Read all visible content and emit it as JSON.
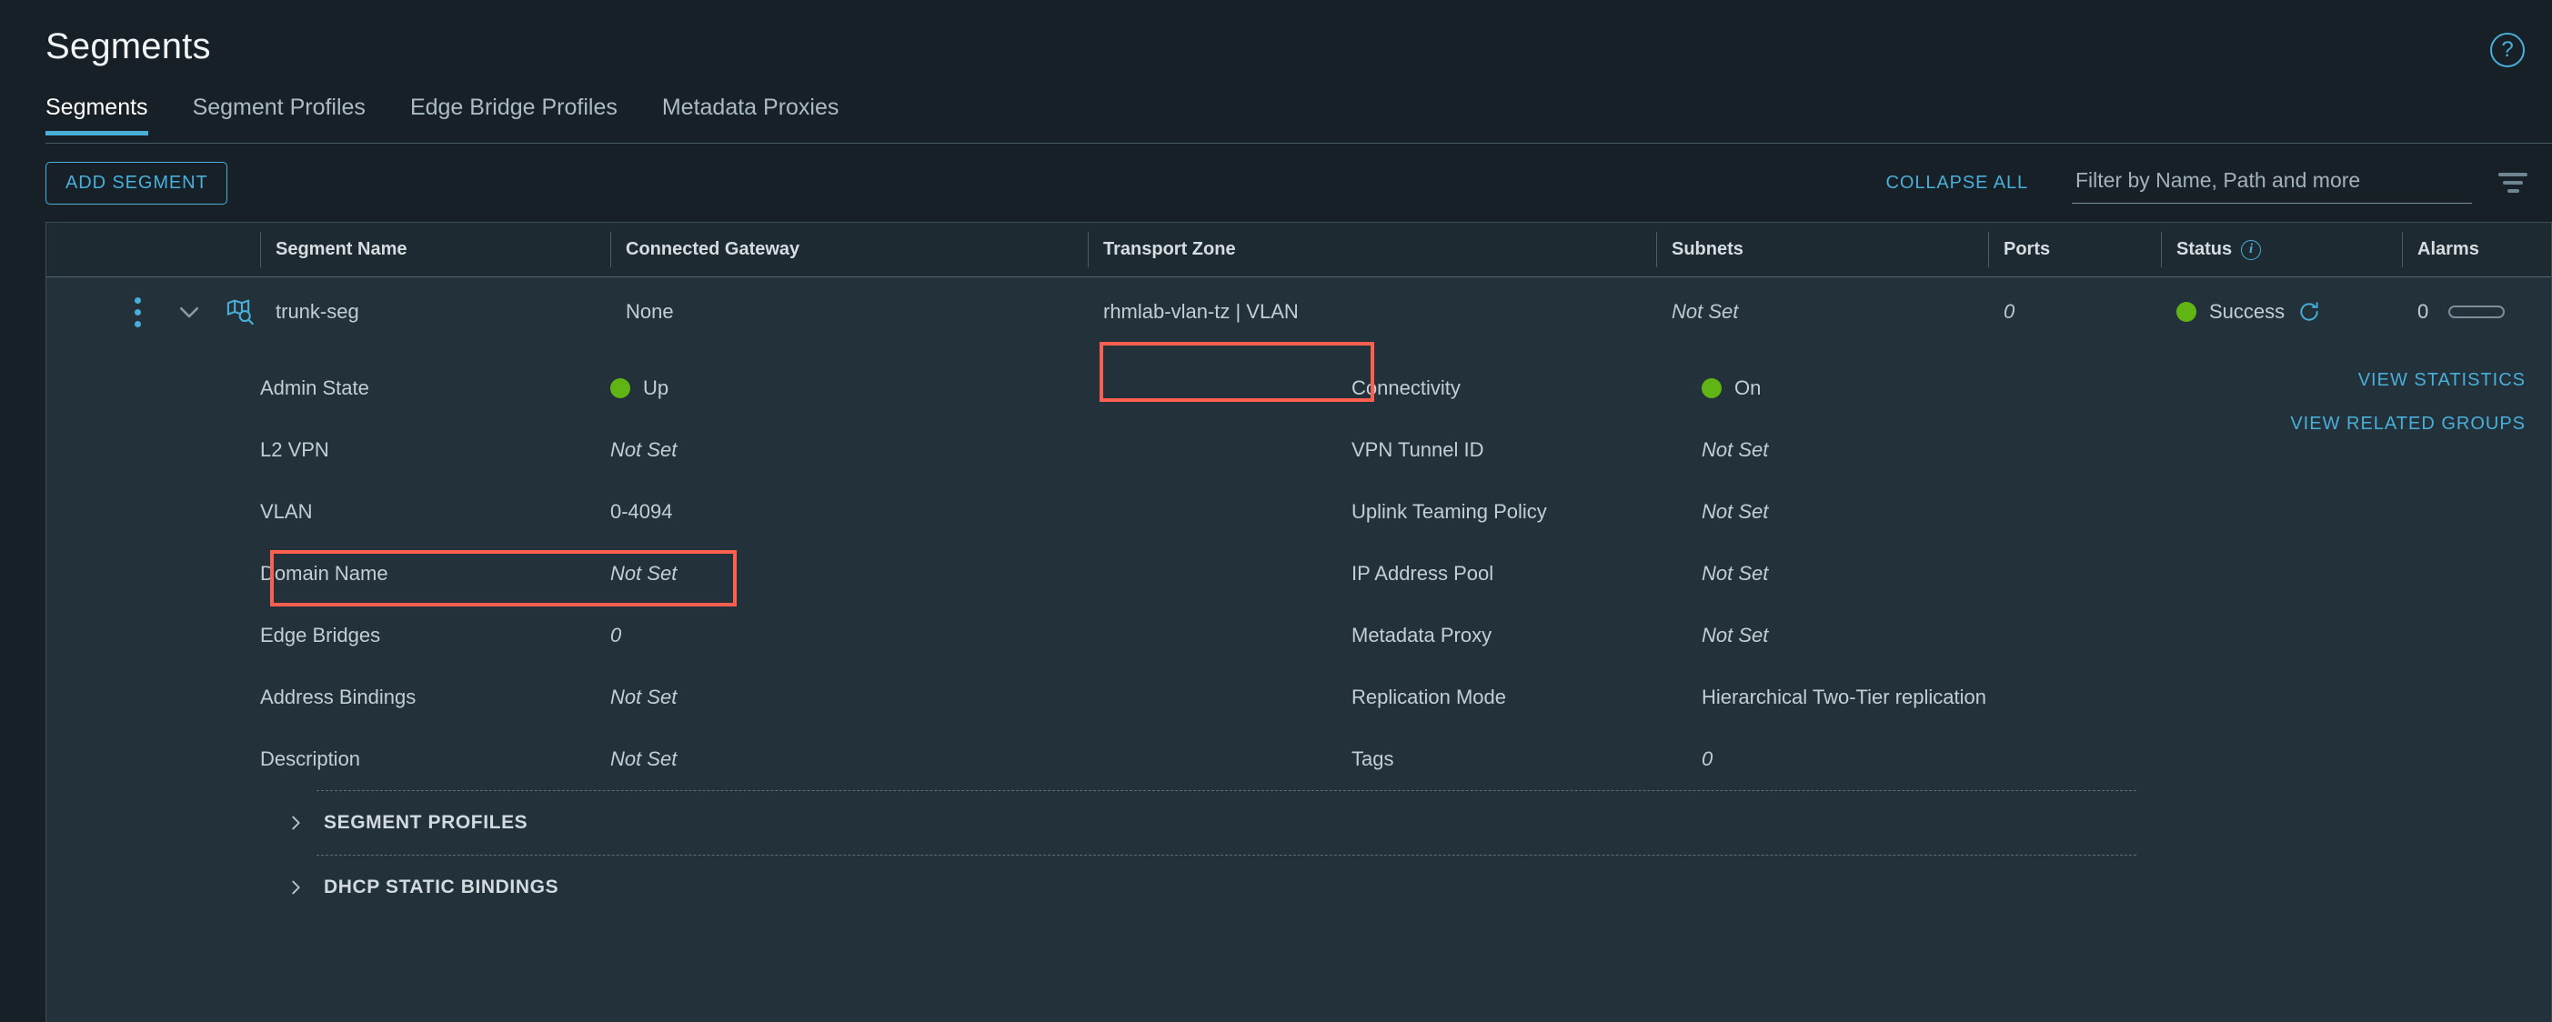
{
  "page": {
    "title": "Segments",
    "help_icon": "help-circle-icon",
    "help_glyph": "?"
  },
  "tabs": [
    {
      "label": "Segments",
      "active": true
    },
    {
      "label": "Segment Profiles",
      "active": false
    },
    {
      "label": "Edge Bridge Profiles",
      "active": false
    },
    {
      "label": "Metadata Proxies",
      "active": false
    }
  ],
  "toolbar": {
    "add_segment_label": "ADD SEGMENT",
    "collapse_all_label": "COLLAPSE ALL",
    "filter_placeholder": "Filter by Name, Path and more",
    "filter_value": "",
    "filter_icon": "filter-icon"
  },
  "table": {
    "columns": [
      {
        "key": "controls",
        "label": ""
      },
      {
        "key": "name",
        "label": "Segment Name"
      },
      {
        "key": "gateway",
        "label": "Connected Gateway"
      },
      {
        "key": "tz",
        "label": "Transport Zone"
      },
      {
        "key": "subnets",
        "label": "Subnets"
      },
      {
        "key": "ports",
        "label": "Ports"
      },
      {
        "key": "status",
        "label": "Status"
      },
      {
        "key": "alarms",
        "label": "Alarms"
      }
    ],
    "status_info_tooltip": "i",
    "row": {
      "segment_name": "trunk-seg",
      "connected_gateway": "None",
      "transport_zone": "rhmlab-vlan-tz | VLAN",
      "subnets": "Not Set",
      "ports": "0",
      "status_text": "Success",
      "status_color": "#60b515",
      "alarms": "0"
    }
  },
  "detail": {
    "left": [
      {
        "label": "Admin State",
        "value": "Up",
        "dot": true,
        "italic": false
      },
      {
        "label": "L2 VPN",
        "value": "Not Set",
        "dot": false,
        "italic": true
      },
      {
        "label": "VLAN",
        "value": "0-4094",
        "dot": false,
        "italic": false
      },
      {
        "label": "Domain Name",
        "value": "Not Set",
        "dot": false,
        "italic": true
      },
      {
        "label": "Edge Bridges",
        "value": "0",
        "dot": false,
        "italic": true
      },
      {
        "label": "Address Bindings",
        "value": "Not Set",
        "dot": false,
        "italic": true
      },
      {
        "label": "Description",
        "value": "Not Set",
        "dot": false,
        "italic": true
      }
    ],
    "right": [
      {
        "label": "Connectivity",
        "value": "On",
        "dot": true,
        "italic": false
      },
      {
        "label": "VPN Tunnel ID",
        "value": "Not Set",
        "dot": false,
        "italic": true
      },
      {
        "label": "Uplink Teaming Policy",
        "value": "Not Set",
        "dot": false,
        "italic": true
      },
      {
        "label": "IP Address Pool",
        "value": "Not Set",
        "dot": false,
        "italic": true
      },
      {
        "label": "Metadata Proxy",
        "value": "Not Set",
        "dot": false,
        "italic": true
      },
      {
        "label": "Replication Mode",
        "value": "Hierarchical Two-Tier replication",
        "dot": false,
        "italic": false
      },
      {
        "label": "Tags",
        "value": "0",
        "dot": false,
        "italic": true
      }
    ],
    "side_links": [
      {
        "label": "VIEW STATISTICS"
      },
      {
        "label": "VIEW RELATED GROUPS"
      }
    ],
    "accordions": [
      {
        "label": "SEGMENT PROFILES"
      },
      {
        "label": "DHCP STATIC BINDINGS"
      }
    ]
  },
  "colors": {
    "page_bg": "#172027",
    "panel_bg": "#23323a",
    "header_bg": "#1e2a31",
    "accent": "#49afd9",
    "status_green": "#60b515",
    "highlight": "#ff5f4f"
  }
}
